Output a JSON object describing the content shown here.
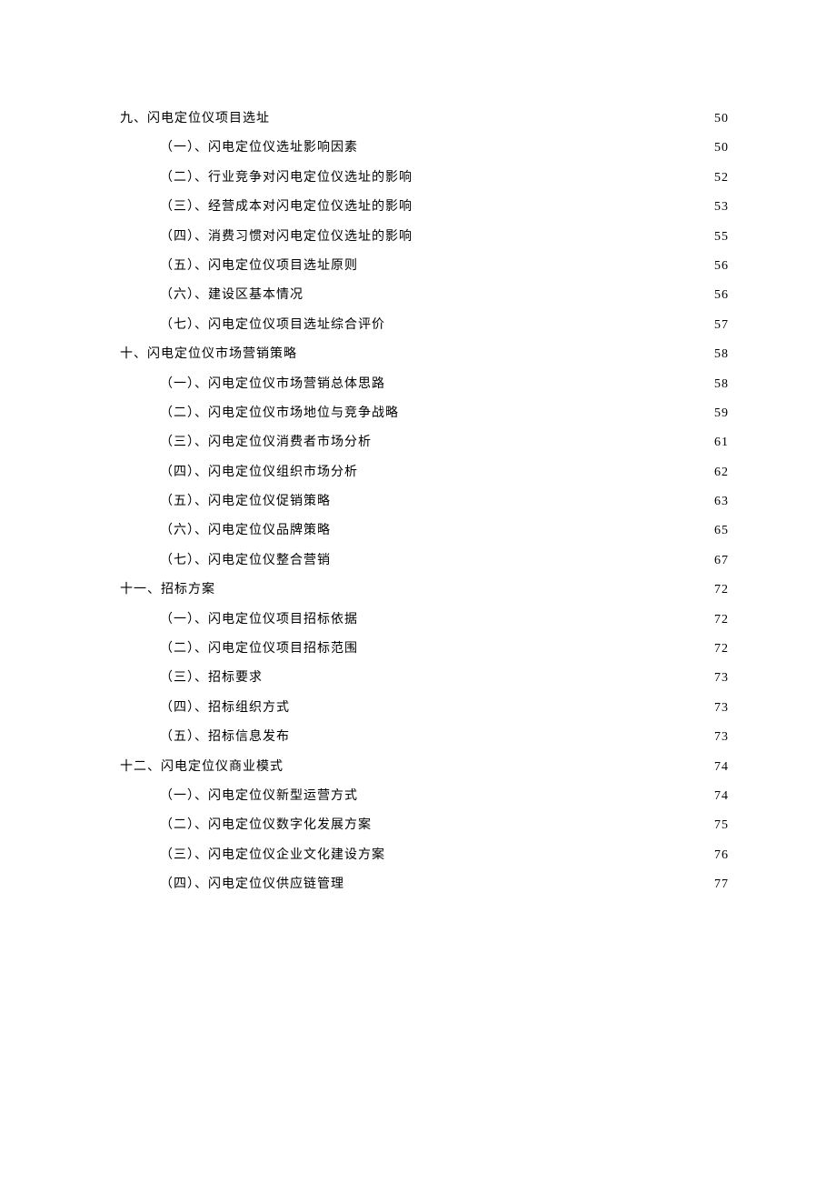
{
  "toc": [
    {
      "level": 1,
      "label": "九、闪电定位仪项目选址",
      "page": "50"
    },
    {
      "level": 2,
      "label": "（一）、闪电定位仪选址影响因素",
      "page": "50"
    },
    {
      "level": 2,
      "label": "（二）、行业竞争对闪电定位仪选址的影响",
      "page": "52"
    },
    {
      "level": 2,
      "label": "（三）、经营成本对闪电定位仪选址的影响",
      "page": "53"
    },
    {
      "level": 2,
      "label": "（四）、消费习惯对闪电定位仪选址的影响",
      "page": "55"
    },
    {
      "level": 2,
      "label": "（五）、闪电定位仪项目选址原则",
      "page": "56"
    },
    {
      "level": 2,
      "label": "（六）、建设区基本情况",
      "page": "56"
    },
    {
      "level": 2,
      "label": "（七）、闪电定位仪项目选址综合评价",
      "page": "57"
    },
    {
      "level": 1,
      "label": "十、闪电定位仪市场营销策略",
      "page": "58"
    },
    {
      "level": 2,
      "label": "（一）、闪电定位仪市场营销总体思路",
      "page": "58"
    },
    {
      "level": 2,
      "label": "（二）、闪电定位仪市场地位与竞争战略",
      "page": "59"
    },
    {
      "level": 2,
      "label": "（三）、闪电定位仪消费者市场分析",
      "page": "61"
    },
    {
      "level": 2,
      "label": "（四）、闪电定位仪组织市场分析",
      "page": "62"
    },
    {
      "level": 2,
      "label": "（五）、闪电定位仪促销策略",
      "page": "63"
    },
    {
      "level": 2,
      "label": "（六）、闪电定位仪品牌策略",
      "page": "65"
    },
    {
      "level": 2,
      "label": "（七）、闪电定位仪整合营销",
      "page": "67"
    },
    {
      "level": 1,
      "label": "十一、招标方案",
      "page": "72"
    },
    {
      "level": 2,
      "label": "（一）、闪电定位仪项目招标依据",
      "page": "72"
    },
    {
      "level": 2,
      "label": "（二）、闪电定位仪项目招标范围",
      "page": "72"
    },
    {
      "level": 2,
      "label": "（三）、招标要求",
      "page": "73"
    },
    {
      "level": 2,
      "label": "（四）、招标组织方式",
      "page": "73"
    },
    {
      "level": 2,
      "label": "（五）、招标信息发布",
      "page": "73"
    },
    {
      "level": 1,
      "label": "十二、闪电定位仪商业模式",
      "page": "74"
    },
    {
      "level": 2,
      "label": "（一）、闪电定位仪新型运营方式",
      "page": "74"
    },
    {
      "level": 2,
      "label": "（二）、闪电定位仪数字化发展方案",
      "page": "75"
    },
    {
      "level": 2,
      "label": "（三）、闪电定位仪企业文化建设方案",
      "page": "76"
    },
    {
      "level": 2,
      "label": "（四）、闪电定位仪供应链管理",
      "page": "77"
    }
  ]
}
